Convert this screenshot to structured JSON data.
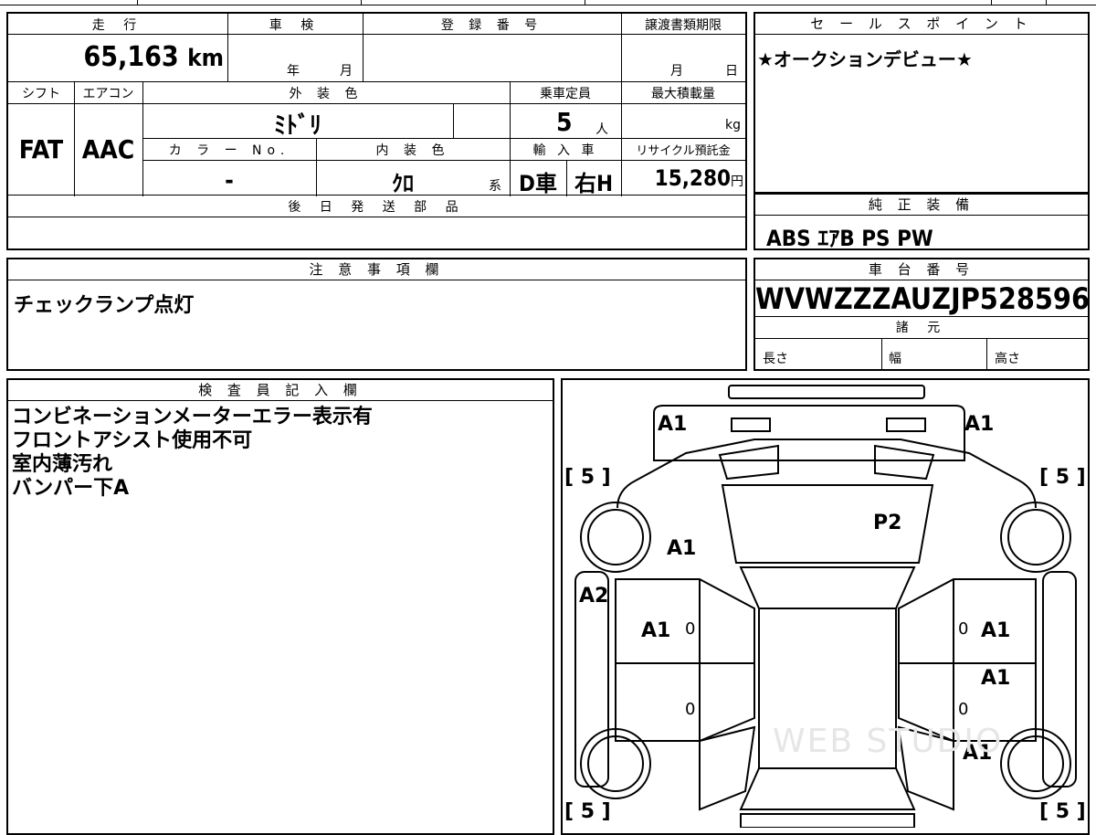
{
  "top_fragment": "",
  "spec_table": {
    "mileage_label": "走 行",
    "mileage_value": "65,163",
    "mileage_unit": "km",
    "inspection_label": "車 検",
    "inspection_year": "年",
    "inspection_month": "月",
    "registration_label": "登 録 番 号",
    "transfer_deadline_label": "譲渡書類期限",
    "transfer_month": "月",
    "transfer_day": "日",
    "shift_label": "シフト",
    "shift_value": "FAT",
    "aircon_label": "エアコン",
    "aircon_value": "AAC",
    "exterior_color_label": "外 装 色",
    "exterior_color_value": "ﾐﾄﾞﾘ",
    "capacity_label": "乗車定員",
    "capacity_value": "5",
    "capacity_unit": "人",
    "max_load_label": "最大積載量",
    "max_load_unit": "kg",
    "color_no_label": "カ ラ ー No.",
    "color_no_value": "-",
    "interior_color_label": "内 装 色",
    "interior_color_value": "ｸﾛ",
    "interior_suffix": "系",
    "import_label": "輸 入 車",
    "import_drive": "D車",
    "import_handle": "右H",
    "recycle_label": "リサイクル預託金",
    "recycle_value": "15,280",
    "recycle_unit": "円",
    "later_parts_label": "後 日 発 送 部 品",
    "later_parts_value": ""
  },
  "sales_point": {
    "label": "セ ー ル ス ポ イ ン ト",
    "value": "★オークションデビュー★"
  },
  "equipment": {
    "label": "純 正 装 備",
    "value": "ABS ｴｱB PS PW"
  },
  "notes": {
    "label": "注 意 事 項 欄",
    "value": "チェックランプ点灯"
  },
  "chassis": {
    "label": "車 台 番 号",
    "value": "WVWZZZAUZJP528596",
    "specs_label": "諸 元",
    "length_label": "長さ",
    "width_label": "幅",
    "height_label": "高さ"
  },
  "inspector": {
    "label": "検 査 員 記 入 欄",
    "lines": [
      "コンビネーションメーターエラー表示有",
      "フロントアシスト使用不可",
      "室内薄汚れ",
      "バンパー下A"
    ]
  },
  "diagram": {
    "marks": [
      "A1",
      "A1",
      "[ 5 ]",
      "[ 5 ]",
      "P2",
      "A1",
      "A2",
      "A1",
      "0",
      "0",
      "A1",
      "A1",
      "0",
      "0",
      "A1",
      "[ 5 ]",
      "[ 5 ]"
    ],
    "watermark": "WEB STUDIO"
  }
}
